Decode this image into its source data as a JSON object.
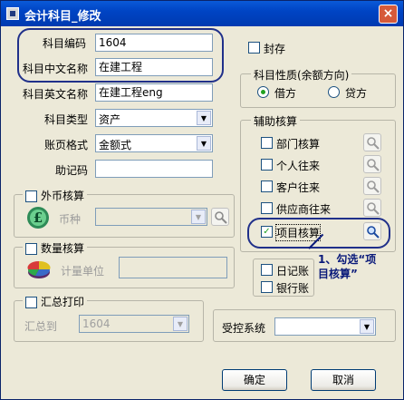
{
  "window": {
    "title": "会计科目_修改",
    "close_glyph": "×"
  },
  "form": {
    "code_label": "科目编码",
    "code_value": "1604",
    "cn_name_label": "科目中文名称",
    "cn_name_value": "在建工程",
    "en_name_label": "科目英文名称",
    "en_name_value": "在建工程eng",
    "type_label": "科目类型",
    "type_value": "资产",
    "page_format_label": "账页格式",
    "page_format_value": "金额式",
    "mnemonic_label": "助记码",
    "mnemonic_value": ""
  },
  "foreign_currency": {
    "label": "外币核算",
    "checked": false,
    "currency_label": "币种",
    "currency_value": ""
  },
  "quantity": {
    "label": "数量核算",
    "checked": false,
    "unit_label": "计量单位",
    "unit_value": ""
  },
  "summary_print": {
    "label": "汇总打印",
    "checked": false,
    "to_label": "汇总到",
    "to_value": "1604"
  },
  "sealed": {
    "label": "封存",
    "checked": false
  },
  "nature": {
    "legend": "科目性质(余额方向)",
    "debit_label": "借方",
    "credit_label": "贷方",
    "selected": "借方"
  },
  "aux": {
    "legend": "辅助核算",
    "items": [
      {
        "label": "部门核算",
        "checked": false
      },
      {
        "label": "个人往来",
        "checked": false
      },
      {
        "label": "客户往来",
        "checked": false
      },
      {
        "label": "供应商往来",
        "checked": false
      },
      {
        "label": "项目核算",
        "checked": true,
        "check_glyph": "✓"
      }
    ]
  },
  "journal": {
    "label": "日记账",
    "checked": false
  },
  "bank": {
    "label": "银行账",
    "checked": false
  },
  "controlled_system": {
    "label": "受控系统",
    "value": ""
  },
  "buttons": {
    "ok": "确定",
    "cancel": "取消"
  },
  "annotation": {
    "line1": "1、勾选“项",
    "line2": "目核算”"
  },
  "colors": {
    "title_bar": "#0044c4",
    "highlight_oval": "#20308a",
    "annotation_text": "#0a1a7a"
  }
}
